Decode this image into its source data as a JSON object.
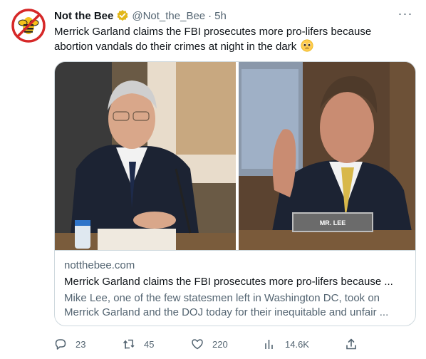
{
  "tweet": {
    "author_name": "Not the Bee",
    "handle": "@Not_the_Bee",
    "separator": "·",
    "time": "5h",
    "text": "Merrick Garland claims the FBI prosecutes more pro-lifers because abortion vandals do their crimes at night in the dark",
    "more_label": "···"
  },
  "card": {
    "domain": "notthebee.com",
    "title": "Merrick Garland claims the FBI prosecutes more pro-lifers because ...",
    "description": "Mike Lee, one of the few statesmen left in Washington DC, took on Merrick Garland and the DOJ today for their inequitable and unfair ...",
    "nameplate": "MR. LEE"
  },
  "actions": {
    "replies": "23",
    "retweets": "45",
    "likes": "220",
    "views": "14.6K"
  },
  "colors": {
    "verified_gold": "#e2b719",
    "muted_text": "#536471",
    "border": "#cfd9de",
    "avatar_red": "#e0245e"
  },
  "icons": [
    "verified-badge-icon",
    "more-icon",
    "reply-icon",
    "retweet-icon",
    "like-icon",
    "views-icon",
    "share-icon",
    "pleading-face-emoji"
  ]
}
